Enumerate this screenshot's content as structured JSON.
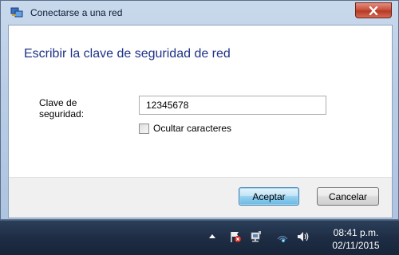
{
  "window": {
    "title": "Conectarse a una red",
    "heading": "Escribir la clave de seguridad de red"
  },
  "form": {
    "key_label": "Clave de seguridad:",
    "key_value": "12345678",
    "hide_chars_label": "Ocultar caracteres",
    "hide_chars_checked": false
  },
  "buttons": {
    "accept": "Aceptar",
    "cancel": "Cancelar"
  },
  "taskbar": {
    "time": "08:41 p.m.",
    "date": "02/11/2015",
    "tray_icons": [
      "show-hidden-icons-arrow",
      "action-center-flag-icon",
      "network-icon",
      "wireless-icon",
      "volume-icon"
    ]
  },
  "colors": {
    "heading": "#1e3287",
    "close_button": "#c9523d",
    "taskbar": "#1e2d44"
  }
}
